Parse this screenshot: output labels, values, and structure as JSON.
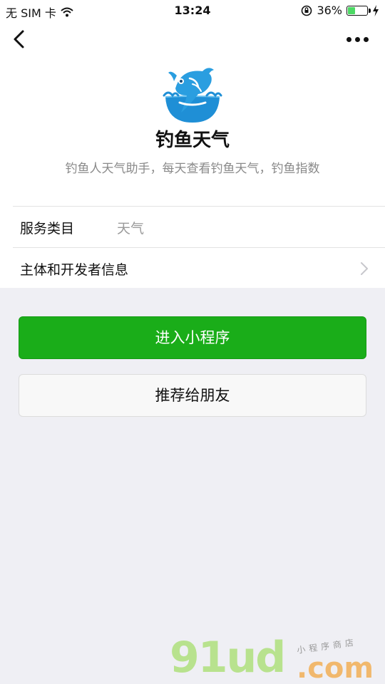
{
  "status_bar": {
    "carrier": "无 SIM 卡",
    "time": "13:24",
    "battery_percent": "36%",
    "battery_level": 0.36
  },
  "nav": {
    "back_icon": "chevron-left-icon",
    "more_icon": "more-dots-icon"
  },
  "app": {
    "name": "钓鱼天气",
    "description": "钓鱼人天气助手，每天查看钓鱼天气，钓鱼指数",
    "logo_icon": "fish-logo-icon"
  },
  "info": {
    "category_label": "服务类目",
    "category_value": "天气",
    "developer_label": "主体和开发者信息"
  },
  "buttons": {
    "enter_label": "进入小程序",
    "share_label": "推荐给朋友"
  },
  "watermark": {
    "big": "91ud",
    "com": ".com",
    "small": "小程序商店"
  },
  "colors": {
    "primary_green": "#1aad19",
    "background": "#efeff4"
  }
}
